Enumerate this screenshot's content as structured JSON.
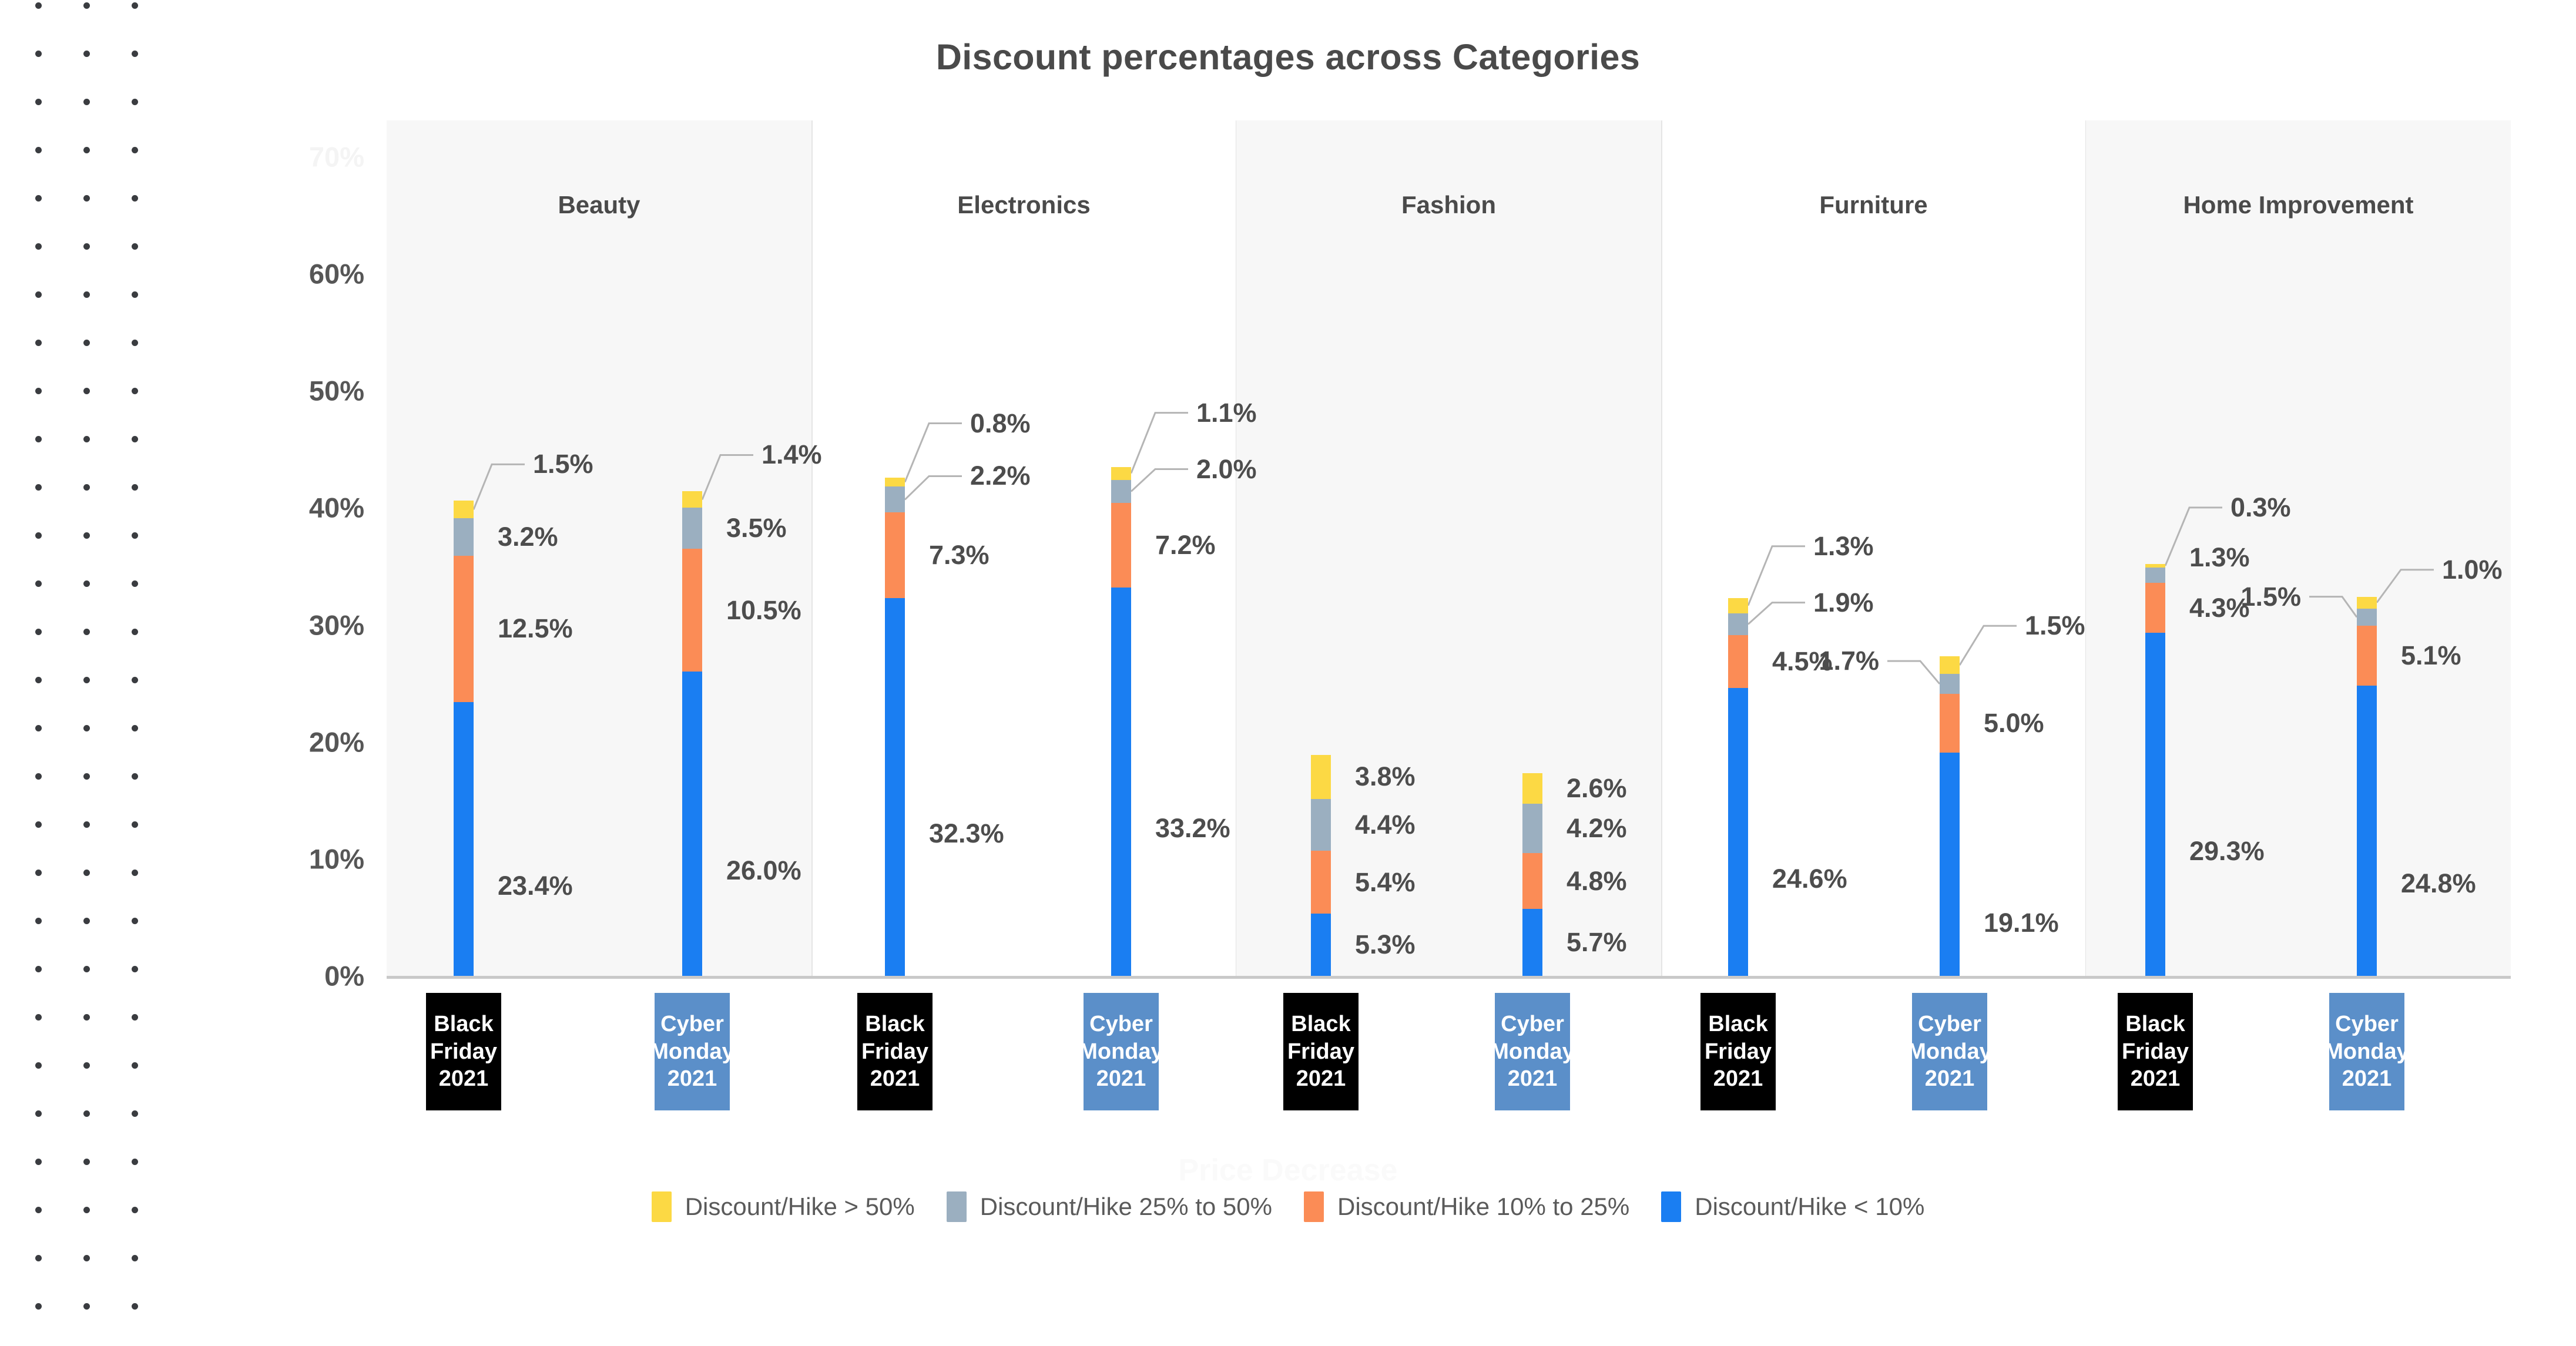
{
  "chart_data": {
    "type": "bar",
    "subtype": "stacked-column-grouped",
    "title": "Discount percentages across Categories",
    "xlabel": "",
    "ylabel": "",
    "ylim": [
      0,
      70
    ],
    "yticks": [
      0,
      10,
      20,
      30,
      40,
      50,
      60,
      70
    ],
    "ytick_labels": [
      "0%",
      "10%",
      "20%",
      "30%",
      "40%",
      "50%",
      "60%",
      "70%"
    ],
    "ytick_faded": [
      "70%"
    ],
    "grid": false,
    "legend_position": "bottom",
    "categories": [
      "Beauty",
      "Electronics",
      "Fashion",
      "Furniture",
      "Home Improvement"
    ],
    "groups": [
      "Black Friday 2021",
      "Cyber Monday 2021"
    ],
    "series": [
      {
        "name": "Discount/Hike > 50%",
        "color": "#fcd944",
        "key": "gt50"
      },
      {
        "name": "Discount/Hike 25% to 50%",
        "color": "#9bafc0",
        "key": "p25to50"
      },
      {
        "name": "Discount/Hike 10% to 25%",
        "color": "#fb8c56",
        "key": "p10to25"
      },
      {
        "name": "Discount/Hike < 10%",
        "color": "#1a7ef2",
        "key": "lt10"
      }
    ],
    "data": [
      {
        "category": "Beauty",
        "bars": [
          {
            "group": "Black Friday 2021",
            "lt10": 23.4,
            "p10to25": 12.5,
            "p25to50": 3.2,
            "gt50": 1.5,
            "total": 40.6
          },
          {
            "group": "Cyber Monday 2021",
            "lt10": 26.0,
            "p10to25": 10.5,
            "p25to50": 3.5,
            "gt50": 1.4,
            "total": 41.4
          }
        ]
      },
      {
        "category": "Electronics",
        "bars": [
          {
            "group": "Black Friday 2021",
            "lt10": 32.3,
            "p10to25": 7.3,
            "p25to50": 2.2,
            "gt50": 0.8,
            "total": 42.6
          },
          {
            "group": "Cyber Monday 2021",
            "lt10": 33.2,
            "p10to25": 7.2,
            "p25to50": 2.0,
            "gt50": 1.1,
            "total": 43.5
          }
        ]
      },
      {
        "category": "Fashion",
        "bars": [
          {
            "group": "Black Friday 2021",
            "lt10": 5.3,
            "p10to25": 5.4,
            "p25to50": 4.4,
            "gt50": 3.8,
            "total": 18.9
          },
          {
            "group": "Cyber Monday 2021",
            "lt10": 5.7,
            "p10to25": 4.8,
            "p25to50": 4.2,
            "gt50": 2.6,
            "total": 17.3
          }
        ]
      },
      {
        "category": "Furniture",
        "bars": [
          {
            "group": "Black Friday 2021",
            "lt10": 24.6,
            "p10to25": 4.5,
            "p25to50": 1.9,
            "gt50": 1.3,
            "total": 32.3
          },
          {
            "group": "Cyber Monday 2021",
            "lt10": 19.1,
            "p10to25": 5.0,
            "p25to50": 1.7,
            "gt50": 1.5,
            "total": 27.3
          }
        ]
      },
      {
        "category": "Home Improvement",
        "bars": [
          {
            "group": "Black Friday 2021",
            "lt10": 29.3,
            "p10to25": 4.3,
            "p25to50": 1.3,
            "gt50": 0.3,
            "total": 35.2
          },
          {
            "group": "Cyber Monday 2021",
            "lt10": 24.8,
            "p10to25": 5.1,
            "p25to50": 1.5,
            "gt50": 1.0,
            "total": 32.4
          }
        ]
      }
    ],
    "data_labels": [
      "1.5%",
      "3.2%",
      "12.5%",
      "23.4%",
      "1.4%",
      "3.5%",
      "10.5%",
      "26.0%",
      "0.8%",
      "2.2%",
      "7.3%",
      "32.3%",
      "1.1%",
      "2.0%",
      "7.2%",
      "33.2%",
      "3.8%",
      "4.4%",
      "5.4%",
      "5.3%",
      "2.6%",
      "4.2%",
      "4.8%",
      "5.7%",
      "1.3%",
      "1.9%",
      "4.5%",
      "24.6%",
      "1.5%",
      "1.7%",
      "5.0%",
      "19.1%",
      "0.3%",
      "1.3%",
      "4.3%",
      "29.3%",
      "1.0%",
      "1.5%",
      "5.1%",
      "24.8%"
    ]
  },
  "header": {
    "title": "Discount percentages across Categories"
  },
  "axis": {
    "y_labels": [
      "70%",
      "60%",
      "50%",
      "40%",
      "30%",
      "20%",
      "10%",
      "0%"
    ]
  },
  "panels": [
    {
      "label": "Beauty"
    },
    {
      "label": "Electronics"
    },
    {
      "label": "Fashion"
    },
    {
      "label": "Furniture"
    },
    {
      "label": "Home Improvement"
    }
  ],
  "xticks": [
    {
      "l1": "Black",
      "l2": "Friday",
      "l3": "2021",
      "kind": "bf"
    },
    {
      "l1": "Cyber",
      "l2": "Monday",
      "l3": "2021",
      "kind": "cm"
    },
    {
      "l1": "Black",
      "l2": "Friday",
      "l3": "2021",
      "kind": "bf"
    },
    {
      "l1": "Cyber",
      "l2": "Monday",
      "l3": "2021",
      "kind": "cm"
    },
    {
      "l1": "Black",
      "l2": "Friday",
      "l3": "2021",
      "kind": "bf"
    },
    {
      "l1": "Cyber",
      "l2": "Monday",
      "l3": "2021",
      "kind": "cm"
    },
    {
      "l1": "Black",
      "l2": "Friday",
      "l3": "2021",
      "kind": "bf"
    },
    {
      "l1": "Cyber",
      "l2": "Monday",
      "l3": "2021",
      "kind": "cm"
    },
    {
      "l1": "Black",
      "l2": "Friday",
      "l3": "2021",
      "kind": "bf"
    },
    {
      "l1": "Cyber",
      "l2": "Monday",
      "l3": "2021",
      "kind": "cm"
    }
  ],
  "legend": {
    "items": [
      {
        "label": "Discount/Hike > 50%",
        "color": "#fcd944"
      },
      {
        "label": "Discount/Hike 25% to 50%",
        "color": "#9bafc0"
      },
      {
        "label": "Discount/Hike 10% to 25%",
        "color": "#fb8c56"
      },
      {
        "label": "Discount/Hike < 10%",
        "color": "#1a7ef2"
      }
    ]
  },
  "ghost": {
    "text": "Price Decrease",
    "text2": ""
  },
  "label_layout": [
    {
      "bar": 0,
      "labels": [
        {
          "key": "gt50",
          "text": "1.5%",
          "side": "right",
          "dx": 110,
          "y_at": "leader",
          "leader": {
            "x1": 38,
            "y1": 6,
            "x2": 78,
            "y2": -52,
            "x3": 140,
            "y3": -52
          }
        },
        {
          "key": "p25to50",
          "text": "3.2%",
          "side": "right",
          "dx": 62
        },
        {
          "key": "p10to25",
          "text": "12.5%",
          "side": "right",
          "dx": 62
        },
        {
          "key": "lt10",
          "text": "23.4%",
          "side": "right",
          "dx": 62,
          "anchor": "bottomish"
        }
      ]
    },
    {
      "bar": 1,
      "labels": [
        {
          "key": "gt50",
          "text": "1.4%",
          "side": "right",
          "dx": 110,
          "leader": {
            "x1": 38,
            "y1": 6,
            "x2": 78,
            "y2": -52,
            "x3": 140,
            "y3": -52
          }
        },
        {
          "key": "p25to50",
          "text": "3.5%",
          "side": "right",
          "dx": 62
        },
        {
          "key": "p10to25",
          "text": "10.5%",
          "side": "right",
          "dx": 62
        },
        {
          "key": "lt10",
          "text": "26.0%",
          "side": "right",
          "dx": 62,
          "anchor": "bottomish"
        }
      ]
    }
  ]
}
